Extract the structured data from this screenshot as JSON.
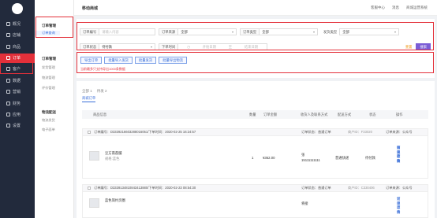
{
  "sidebar": {
    "items": [
      {
        "label": "概况",
        "icon": "dashboard-icon",
        "active": false
      },
      {
        "label": "店铺",
        "icon": "shop-icon",
        "active": false
      },
      {
        "label": "商品",
        "icon": "goods-icon",
        "active": false
      },
      {
        "label": "订单",
        "icon": "order-icon",
        "active": true
      },
      {
        "label": "客户",
        "icon": "customer-icon",
        "active": false
      },
      {
        "label": "数据",
        "icon": "data-icon",
        "active": false
      },
      {
        "label": "营销",
        "icon": "marketing-icon",
        "active": false
      },
      {
        "label": "财务",
        "icon": "finance-icon",
        "active": false
      },
      {
        "label": "应用",
        "icon": "apps-icon",
        "active": false
      },
      {
        "label": "设置",
        "icon": "settings-icon",
        "active": false
      }
    ]
  },
  "subnav": {
    "group1": "订单管理",
    "group1_items": [
      "订单查询"
    ],
    "group2": "订单管理",
    "group2_items": [
      "发货管理",
      "物流管理",
      "评价管理"
    ],
    "group3": "物流配送",
    "group3_items": [
      "物流发货",
      "电子面单"
    ]
  },
  "topbar": {
    "title": "移动商城",
    "links": [
      "客服中心",
      "消息",
      "商城运营系统"
    ]
  },
  "filters": {
    "order_no": {
      "label": "订单编号",
      "placeholder": "请输入内容"
    },
    "source": {
      "label": "订单来源",
      "value": "全部"
    },
    "type": {
      "label": "订单类型",
      "value": "全部"
    },
    "delivery": {
      "label": "发货类型",
      "value": "全部"
    },
    "status": {
      "label": "订单状态",
      "value": "待付款"
    },
    "time": {
      "label": "下单时间",
      "start": "开始日期",
      "sep": "至",
      "end": "结束日期"
    },
    "reset": "重置",
    "search": "搜索"
  },
  "actions": {
    "export": "导出订单",
    "batch_ship": "批量导入发货",
    "batch_send": "批量发货",
    "batch_print": "批量导出物流",
    "notice": "当前最多只支持导出1000条数据"
  },
  "tabs": {
    "all": "全部",
    "all_count": "1",
    "other": "待发",
    "other_count": "2",
    "subtab": "商城订单"
  },
  "table": {
    "columns": [
      "商品信息",
      "数量",
      "订单金额",
      "收货人及联系方式",
      "配送方式",
      "状态",
      "操作"
    ]
  },
  "orders": [
    {
      "no_label": "订单编号：D3339216603288016051/下单时间：2020-02-25 16:24:57",
      "biz": "订单状态：普通订单",
      "shop_id": "商户ID：F33020",
      "source": "订单来源：公众号",
      "goods_name": "豆方南荔脯",
      "goods_spec": "规格:蓝色",
      "qty": "1",
      "amount": "¥362.00",
      "receiver": "张",
      "phone": "15111111111",
      "shipping": "普通快递",
      "status": "待付款",
      "ops": [
        "订单详情",
        "订单改价",
        "关闭订单",
        "确认收款"
      ]
    },
    {
      "no_label": "订单编号：D3339134810843413880/下单时间：2020-02-23 08:54:30",
      "biz": "订单状态：普通订单",
      "shop_id": "商户ID：C330406",
      "source": "订单来源：公众号",
      "goods_name": "蓝色简约页圈",
      "goods_spec": "",
      "qty": "",
      "amount": "",
      "receiver": "将接",
      "phone": "",
      "shipping": "",
      "status": "",
      "ops": [
        "订单详情",
        "订单改价",
        "关闭订单"
      ]
    }
  ],
  "colors": {
    "sidebar": "#222a3c",
    "active": "#e3303a",
    "primary": "#7b5dd6",
    "link": "#3a6fd8"
  }
}
